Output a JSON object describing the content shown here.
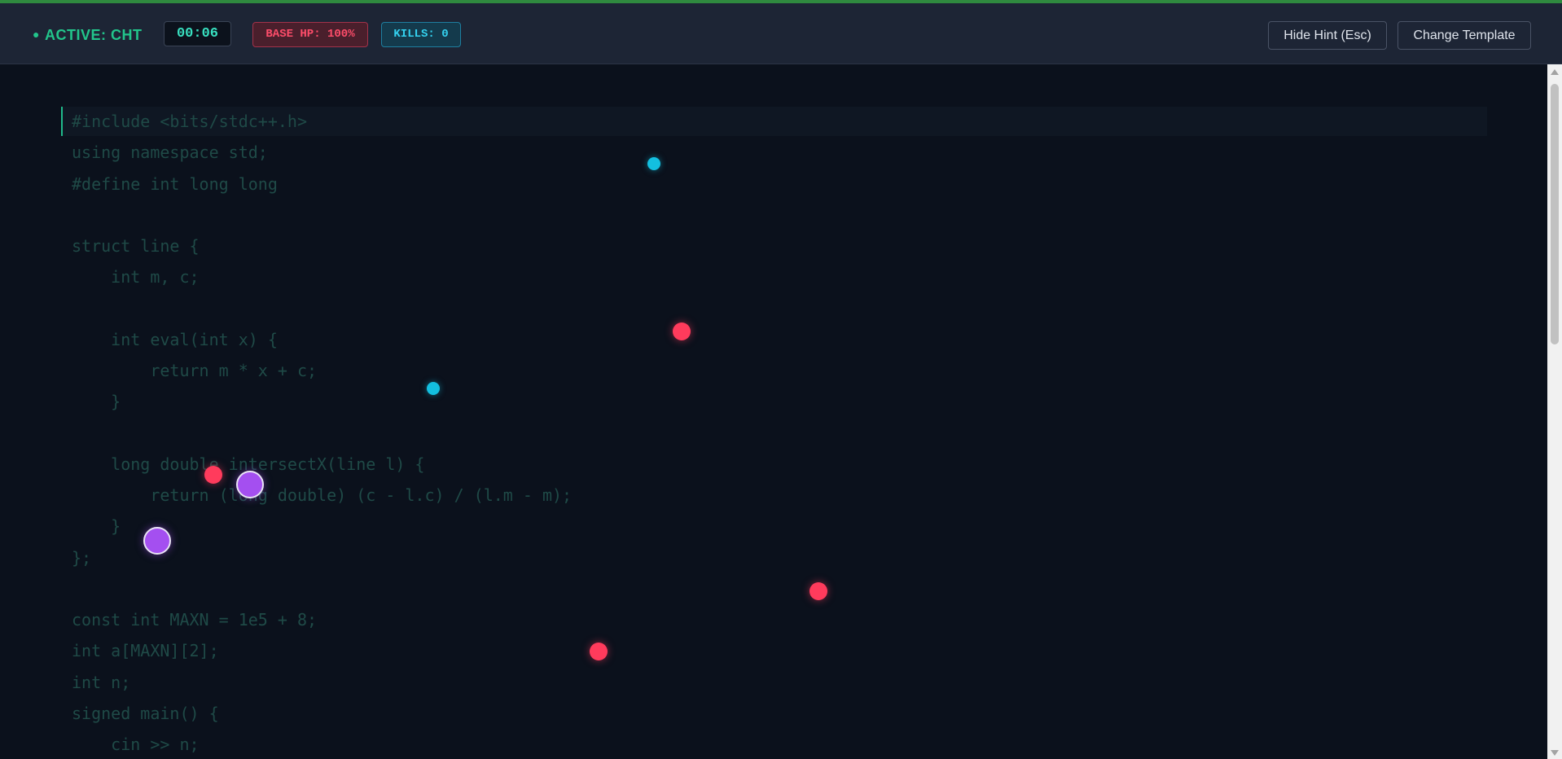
{
  "header": {
    "status_dot": "●",
    "status": "ACTIVE: CHT",
    "timer": "00:06",
    "base_hp": "BASE HP: 100%",
    "kills": "KILLS: 0",
    "hide_hint_button": "Hide Hint (Esc)",
    "change_template_button": "Change Template"
  },
  "code": {
    "lines": [
      "#include <bits/stdc++.h>",
      "using namespace std;",
      "#define int long long",
      "",
      "struct line {",
      "    int m, c;",
      "",
      "    int eval(int x) {",
      "        return m * x + c;",
      "    }",
      "",
      "    long double intersectX(line l) {",
      "        return (long double) (c - l.c) / (l.m - m);",
      "    }",
      "};",
      "",
      "const int MAXN = 1e5 + 8;",
      "int a[MAXN][2];",
      "int n;",
      "signed main() {",
      "    cin >> n;"
    ]
  },
  "colors": {
    "accent_green": "#22c58b",
    "timer_text": "#38e0c0",
    "hp_red": "#ff4d6a",
    "kills_cyan": "#34d2f0",
    "code_text": "#1f4a47",
    "enemy_red": "#ff3b5c",
    "enemy_cyan": "#13bfe0",
    "enemy_purple": "#a44ff0"
  }
}
